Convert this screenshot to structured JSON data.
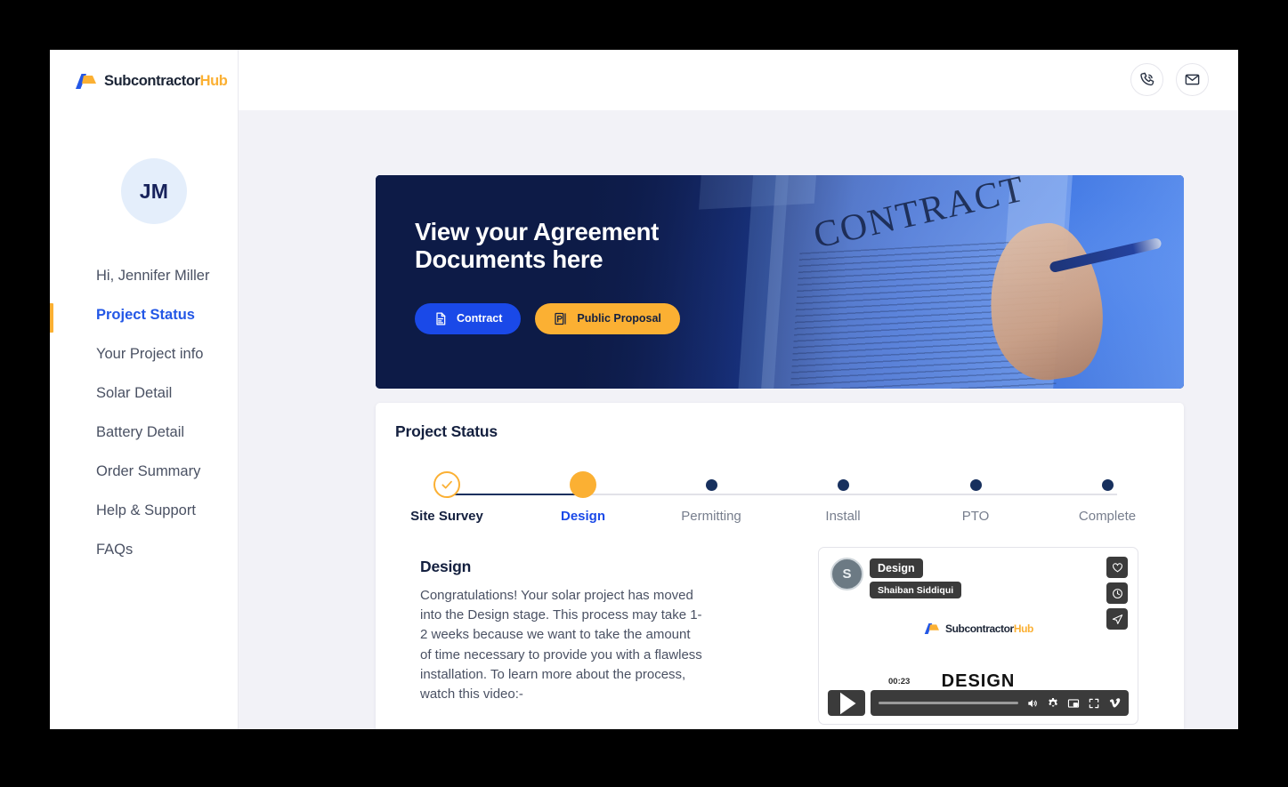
{
  "brand": {
    "name_primary": "Subcontractor",
    "name_accent": "Hub"
  },
  "sidebar": {
    "avatar_initials": "JM",
    "greeting": "Hi, Jennifer Miller",
    "items": [
      {
        "label": "Project Status",
        "active": true
      },
      {
        "label": "Your Project info",
        "active": false
      },
      {
        "label": "Solar Detail",
        "active": false
      },
      {
        "label": "Battery Detail",
        "active": false
      },
      {
        "label": "Order Summary",
        "active": false
      },
      {
        "label": "Help & Support",
        "active": false
      },
      {
        "label": "FAQs",
        "active": false
      }
    ]
  },
  "header": {
    "call_icon": "phone-call-icon",
    "mail_icon": "envelope-icon"
  },
  "hero": {
    "title_line1": "View your Agreement",
    "title_line2": "Documents here",
    "contract_button": "Contract",
    "proposal_button": "Public Proposal",
    "contract_color": "#1a49e8",
    "proposal_color": "#fbb033",
    "image_word": "CONTRACT"
  },
  "status_card": {
    "title": "Project Status",
    "steps": [
      {
        "label": "Site Survey",
        "state": "done"
      },
      {
        "label": "Design",
        "state": "current"
      },
      {
        "label": "Permitting",
        "state": "upcoming"
      },
      {
        "label": "Install",
        "state": "upcoming"
      },
      {
        "label": "PTO",
        "state": "upcoming"
      },
      {
        "label": "Complete",
        "state": "upcoming"
      }
    ],
    "detail_heading": "Design",
    "detail_body": "Congratulations! Your solar project has moved into the Design stage. This process may take 1-2 weeks because we want to take the amount of time necessary to provide you with a flawless installation. To learn more about the process, watch this video:-"
  },
  "video": {
    "avatar_initial": "S",
    "title": "Design",
    "author": "Shaiban Siddiqui",
    "overlay_word": "DESIGN",
    "timestamp": "00:23",
    "side_actions": [
      "heart-icon",
      "clock-icon",
      "share-icon"
    ],
    "controls": [
      "play-icon",
      "volume-icon",
      "gear-icon",
      "picture-in-picture-icon",
      "fullscreen-icon",
      "vimeo-icon"
    ]
  },
  "colors": {
    "accent_blue": "#1a49e8",
    "accent_amber": "#fbb033",
    "navy": "#14203f",
    "page_bg": "#f2f2f7"
  }
}
